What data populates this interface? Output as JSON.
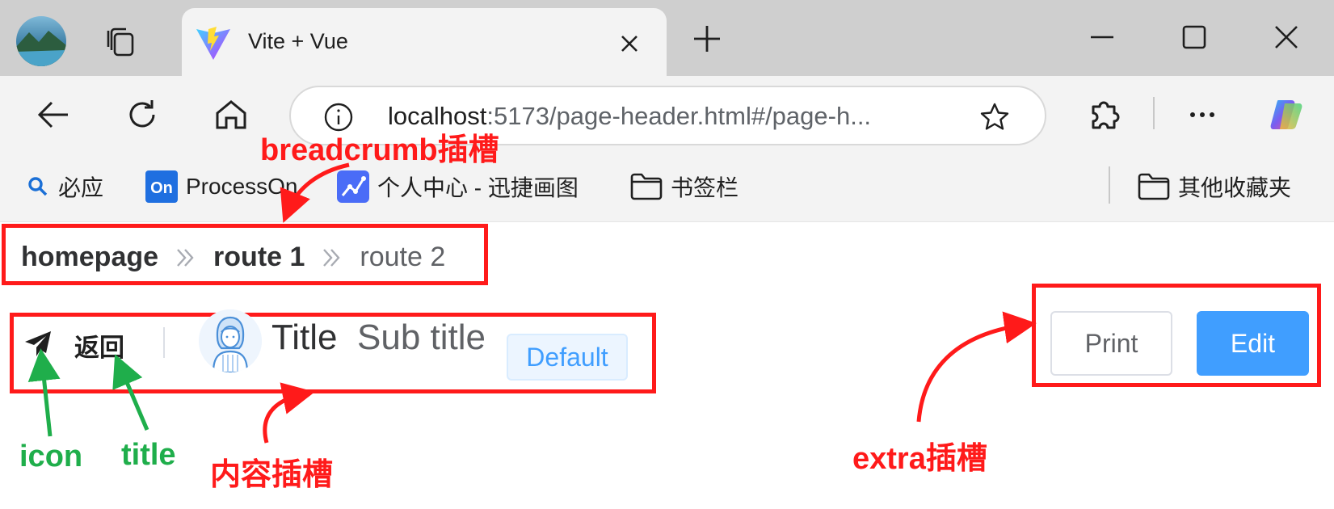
{
  "browser": {
    "tab": {
      "title": "Vite + Vue"
    },
    "address": {
      "host": "localhost",
      "path": ":5173/page-header.html#/page-h..."
    },
    "favorites": [
      {
        "label": "必应",
        "icon": "bing-search-icon"
      },
      {
        "label": "ProcessOn",
        "icon": "processon-icon"
      },
      {
        "label": "个人中心 - 迅捷画图",
        "icon": "xunjie-icon"
      },
      {
        "label": "书签栏",
        "icon": "folder-icon"
      }
    ],
    "other_favorites": {
      "label": "其他收藏夹",
      "icon": "folder-icon"
    }
  },
  "page_header": {
    "breadcrumb": [
      {
        "label": "homepage"
      },
      {
        "label": "route 1"
      },
      {
        "label": "route 2"
      }
    ],
    "back": {
      "icon": "paper-plane-icon",
      "label": "返回"
    },
    "title": "Title",
    "subtitle": "Sub title",
    "tag": "Default",
    "extra": {
      "print_label": "Print",
      "edit_label": "Edit"
    }
  },
  "annotations": {
    "breadcrumb_slot": "breadcrumb插槽",
    "content_slot": "内容插槽",
    "extra_slot": "extra插槽",
    "icon": "icon",
    "title": "title"
  },
  "colors": {
    "annotation_red": "#ff1a1a",
    "annotation_green": "#1fae4b",
    "primary": "#409eff",
    "tag_bg": "#ecf5ff"
  }
}
